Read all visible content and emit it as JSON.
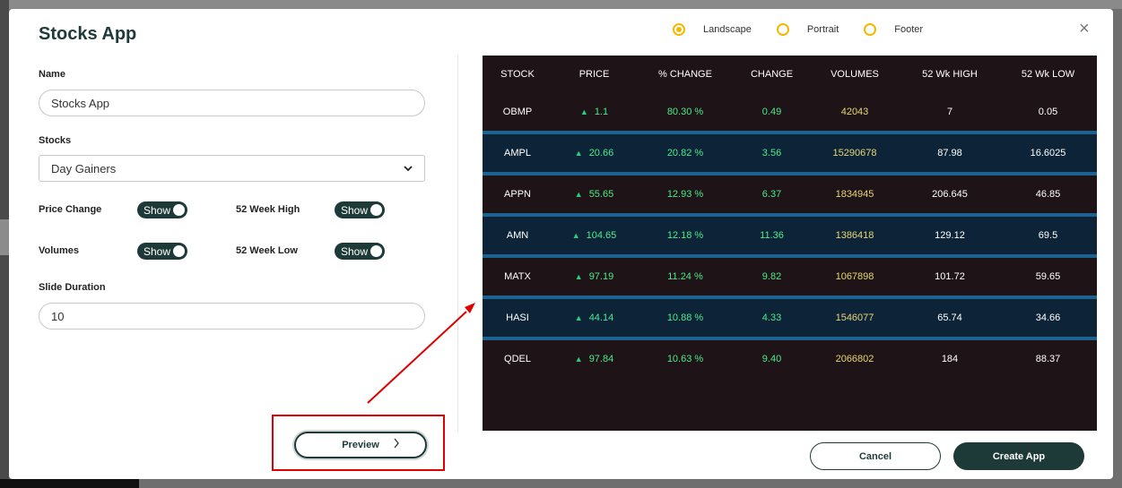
{
  "app": {
    "title": "Stocks App",
    "close_glyph": "×"
  },
  "layout_options": [
    {
      "label": "Landscape",
      "checked": true
    },
    {
      "label": "Portrait",
      "checked": false
    },
    {
      "label": "Footer",
      "checked": false
    }
  ],
  "form": {
    "name_label": "Name",
    "name_value": "Stocks App",
    "stocks_label": "Stocks",
    "stocks_value": "Day Gainers",
    "price_change_label": "Price Change",
    "price_change_toggle": "Show",
    "week52_high_label": "52 Week High",
    "week52_high_toggle": "Show",
    "volumes_label": "Volumes",
    "volumes_toggle": "Show",
    "week52_low_label": "52 Week Low",
    "week52_low_toggle": "Show",
    "slide_duration_label": "Slide Duration",
    "slide_duration_value": "10"
  },
  "buttons": {
    "preview": "Preview",
    "cancel": "Cancel",
    "create": "Create App"
  },
  "colors": {
    "accent": "#1e3a38",
    "radio": "#f5b800",
    "highlight": "#e00000",
    "up": "#27d07a"
  },
  "table": {
    "headers": [
      "STOCK",
      "PRICE",
      "% CHANGE",
      "CHANGE",
      "VOLUMES",
      "52 Wk HIGH",
      "52 Wk LOW"
    ],
    "rows": [
      {
        "stock": "OBMP",
        "price": "1.1",
        "pct": "80.30 %",
        "change": "0.49",
        "volume": "42043",
        "high": "7",
        "low": "0.05"
      },
      {
        "stock": "AMPL",
        "price": "20.66",
        "pct": "20.82 %",
        "change": "3.56",
        "volume": "15290678",
        "high": "87.98",
        "low": "16.6025"
      },
      {
        "stock": "APPN",
        "price": "55.65",
        "pct": "12.93 %",
        "change": "6.37",
        "volume": "1834945",
        "high": "206.645",
        "low": "46.85"
      },
      {
        "stock": "AMN",
        "price": "104.65",
        "pct": "12.18 %",
        "change": "11.36",
        "volume": "1386418",
        "high": "129.12",
        "low": "69.5"
      },
      {
        "stock": "MATX",
        "price": "97.19",
        "pct": "11.24 %",
        "change": "9.82",
        "volume": "1067898",
        "high": "101.72",
        "low": "59.65"
      },
      {
        "stock": "HASI",
        "price": "44.14",
        "pct": "10.88 %",
        "change": "4.33",
        "volume": "1546077",
        "high": "65.74",
        "low": "34.66"
      },
      {
        "stock": "QDEL",
        "price": "97.84",
        "pct": "10.63 %",
        "change": "9.40",
        "volume": "2066802",
        "high": "184",
        "low": "88.37"
      }
    ]
  }
}
